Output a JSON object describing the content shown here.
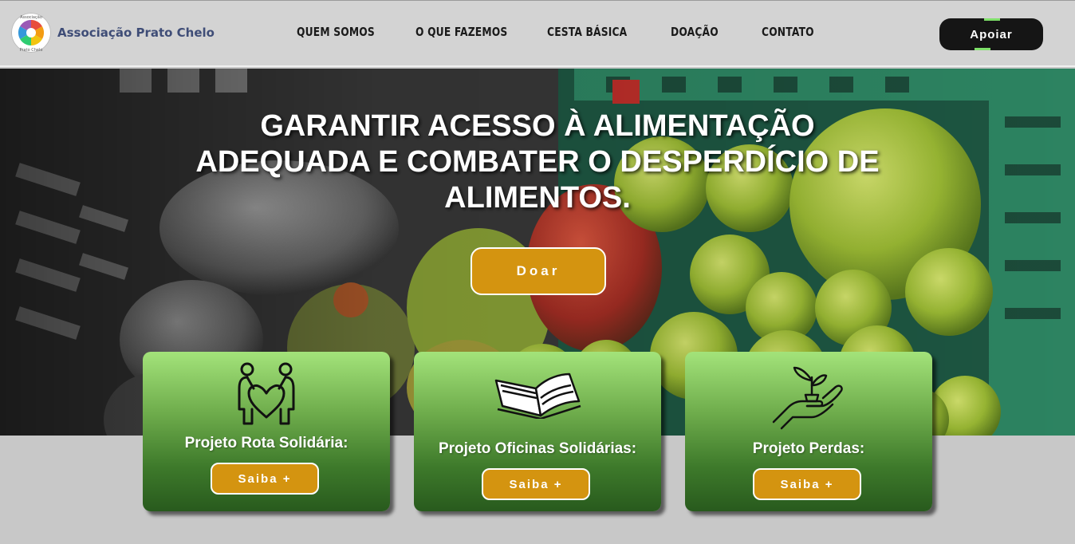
{
  "header": {
    "logo_text": "Associação Prato Chelo",
    "logo_ring_text_top": "Associação",
    "logo_ring_text_bottom": "Prato Chelo",
    "nav": [
      {
        "label": "QUEM SOMOS"
      },
      {
        "label": "O QUE FAZEMOS"
      },
      {
        "label": "CESTA BÁSICA"
      },
      {
        "label": "DOAÇÃO"
      },
      {
        "label": "CONTATO"
      }
    ],
    "cta_label": "Apoiar"
  },
  "hero": {
    "title_line1": "GARANTIR ACESSO À ALIMENTAÇÃO",
    "title_line2": "ADEQUADA E COMBATER O DESPERDÍCIO DE",
    "title_line3": "ALIMENTOS.",
    "donate_label": "Doar",
    "background": "fruit-crate-photo"
  },
  "cards": [
    {
      "title": "Projeto Rota Solidária:",
      "button_label": "Saiba +",
      "icon": "people-heart-icon"
    },
    {
      "title": "Projeto Oficinas Solidárias:",
      "button_label": "Saiba +",
      "icon": "open-book-icon"
    },
    {
      "title": "Projeto Perdas:",
      "button_label": "Saiba +",
      "icon": "hand-plant-icon"
    }
  ],
  "colors": {
    "accent_gold": "#d49410",
    "header_bg": "#d3d3d3",
    "logo_text": "#3f4d77",
    "card_green_top": "#a3e37a",
    "card_green_bottom": "#285a1d",
    "cta_bg": "#151515"
  }
}
